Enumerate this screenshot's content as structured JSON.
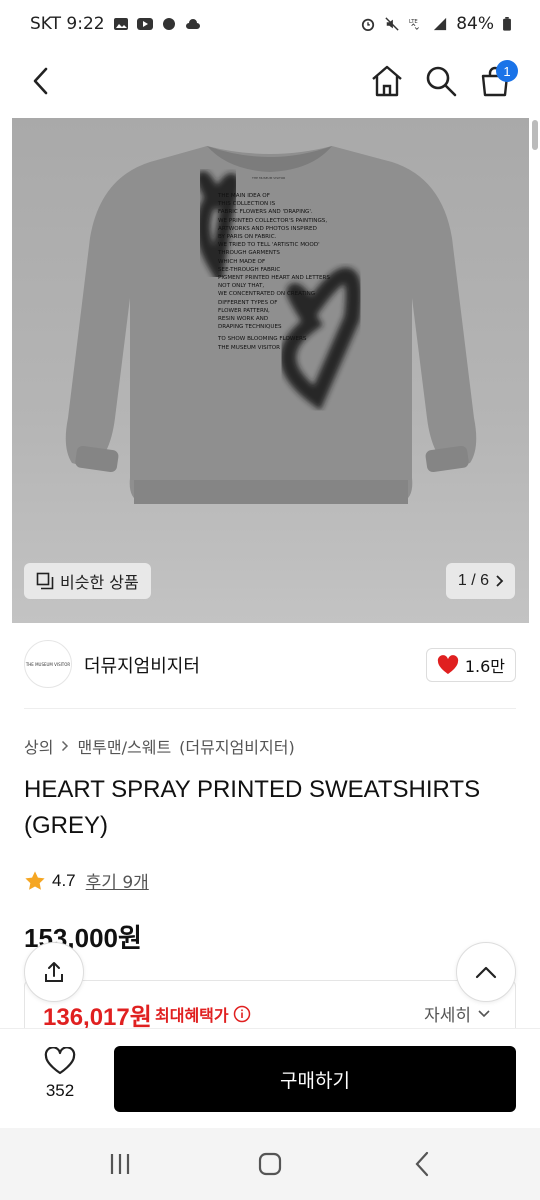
{
  "status_bar": {
    "carrier_time": "SKT 9:22",
    "battery": "84%"
  },
  "header": {
    "back_icon": "chevron-left-icon",
    "home_icon": "home-icon",
    "search_icon": "search-icon",
    "cart_icon": "shopping-bag-icon",
    "cart_count": "1"
  },
  "product_image": {
    "similar_label": "비슷한 상품",
    "page_indicator": "1 / 6",
    "print_text": [
      "THE MAIN IDEA OF",
      "THIS COLLECTION IS",
      "FABRIC FLOWERS AND 'DRAPING'.",
      "WE PRINTED COLLECTOR'S PAINTINGS,",
      "ARTWORKS AND PHOTOS INSPIRED",
      "BY PARIS ON FABRIC.",
      "WE TRIED TO TELL 'ARTISTIC MOOD'",
      "THROUGH GARMENTS",
      "WHICH MADE OF",
      "SEE-THROUGH FABRIC",
      "PIGMENT PRINTED HEART AND LETTERS",
      "NOT ONLY THAT,",
      "WE CONCENTRATED ON CREATING",
      "DIFFERENT TYPES OF",
      "FLOWER PATTERN,",
      "RESIN WORK AND",
      "DRAPING TECHNIQUES",
      "",
      "TO SHOW BLOOMING FLOWERS",
      "THE MUSEUM VISITOR"
    ],
    "neck_label": "THE MUSEUM VISITOR"
  },
  "brand": {
    "logo_text": "THE MUSEUM VISITOR",
    "name": "더뮤지엄비지터",
    "like_count": "1.6만"
  },
  "breadcrumb": {
    "level1": "상의",
    "level2": "맨투맨/스웨트",
    "brand_paren": "(더뮤지엄비지터)"
  },
  "product": {
    "title": "HEART SPRAY PRINTED SWEATSHIRTS (GREY)",
    "rating": "4.7",
    "review_link": "후기 9개",
    "price": "153,000원"
  },
  "benefit": {
    "price": "136,017원",
    "label": "최대혜택가",
    "detail": "자세히"
  },
  "bottom_bar": {
    "wish_count": "352",
    "buy_label": "구매하기"
  },
  "colors": {
    "accent_red": "#e02020",
    "badge_blue": "#1a73e8",
    "buy_button": "#000000"
  }
}
